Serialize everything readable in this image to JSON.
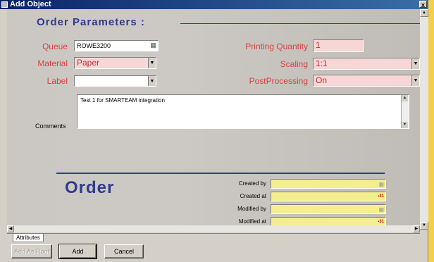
{
  "window": {
    "title": "Add Object",
    "close_glyph": "x"
  },
  "order_parameters": {
    "section_title": "Order Parameters :",
    "queue": {
      "label": "Queue",
      "value": "ROWE3200"
    },
    "material": {
      "label": "Material",
      "value": "Paper"
    },
    "label": {
      "label": "Label",
      "value": ""
    },
    "printing_quantity": {
      "label": "Printing Quantity",
      "value": "1"
    },
    "scaling": {
      "label": "Scaling",
      "value": "1:1"
    },
    "post_processing": {
      "label": "PostProcessing",
      "value": "On"
    },
    "comments": {
      "label": "Comments",
      "value": "Test 1 for SMARTEAM integration"
    }
  },
  "order_section": {
    "title": "Order",
    "created_by": {
      "label": "Created by",
      "value": ""
    },
    "created_at": {
      "label": "Created at",
      "value": ""
    },
    "modified_by": {
      "label": "Modified by",
      "value": ""
    },
    "modified_at": {
      "label": "Modified at",
      "value": ""
    }
  },
  "tabs": [
    {
      "label": "Attributes"
    }
  ],
  "buttons": {
    "add_as_root": "Add As Root",
    "add": "Add",
    "cancel": "Cancel"
  },
  "colors": {
    "accent": "#2e3b8f",
    "label_red": "#d94040",
    "field_pink": "#f7d6d6",
    "field_yellow": "#f4ef8c",
    "desktop": "#f2cf4d"
  }
}
